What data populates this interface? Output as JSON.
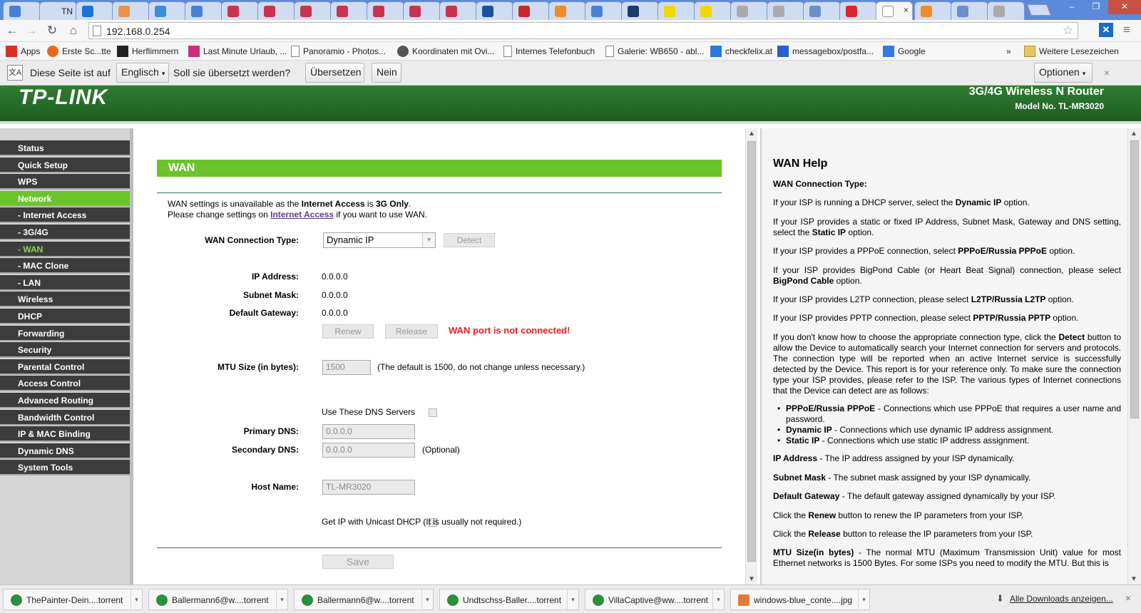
{
  "tabs": [
    {
      "label": "",
      "color": "#4a7fd6"
    },
    {
      "label": "TN",
      "color": "#cfdcf2"
    },
    {
      "label": "",
      "color": "#1a73d9"
    },
    {
      "label": "",
      "color": "#e8924c"
    },
    {
      "label": "",
      "color": "#3b8fd6"
    },
    {
      "label": "",
      "color": "#4a7fd6"
    },
    {
      "label": "",
      "color": "#c8344e"
    },
    {
      "label": "",
      "color": "#c8344e"
    },
    {
      "label": "",
      "color": "#c8344e"
    },
    {
      "label": "",
      "color": "#c8344e"
    },
    {
      "label": "",
      "color": "#c8344e"
    },
    {
      "label": "",
      "color": "#c8344e"
    },
    {
      "label": "",
      "color": "#c8344e"
    },
    {
      "label": "",
      "color": "#1a4fa0"
    },
    {
      "label": "",
      "color": "#c62828"
    },
    {
      "label": "",
      "color": "#f08c28"
    },
    {
      "label": "",
      "color": "#4a7fd6"
    },
    {
      "label": "",
      "color": "#1c3a6b"
    },
    {
      "label": "",
      "color": "#f2d600"
    },
    {
      "label": "",
      "color": "#f2d600"
    },
    {
      "label": "",
      "color": "#aaaaaa"
    },
    {
      "label": "",
      "color": "#aaaaaa"
    },
    {
      "label": "",
      "color": "#6b8fc6"
    },
    {
      "label": "",
      "color": "#d9272e"
    }
  ],
  "active_tab": {
    "label": "",
    "close": "×"
  },
  "after_tabs": [
    {
      "label": "",
      "color": "#f08c28"
    },
    {
      "label": "",
      "color": "#6b8fc6"
    },
    {
      "label": "",
      "color": "#aaaaaa"
    }
  ],
  "window_controls": {
    "minimize": "–",
    "restore": "❐",
    "close": "✕"
  },
  "nav": {
    "back": "←",
    "forward": "→",
    "reload": "↻",
    "home": "⌂"
  },
  "address": {
    "url": "192.168.0.254",
    "star": "☆"
  },
  "menu_icon": "≡",
  "extension_icon": "✕",
  "bookmarks": [
    {
      "label": "Apps",
      "icon": "apps-icon"
    },
    {
      "label": "Erste Sc...tte",
      "icon": "firefox-icon"
    },
    {
      "label": "Herflimmern",
      "icon": "l-icon"
    },
    {
      "label": "Last Minute Urlaub, ...",
      "icon": "palm-icon"
    },
    {
      "label": "Panoramio - Photos...",
      "icon": "page-icon"
    },
    {
      "label": "Koordinaten mit Ovi...",
      "icon": "wordpress-icon"
    },
    {
      "label": "Internes Telefonbuch",
      "icon": "page-icon"
    },
    {
      "label": "Galerie: WB650 - abl...",
      "icon": "page-icon"
    },
    {
      "label": "checkfelix.at",
      "icon": "plane-icon"
    },
    {
      "label": "messagebox/postfa...",
      "icon": "mail-icon"
    },
    {
      "label": "Google",
      "icon": "google-icon"
    }
  ],
  "bookmarks_more": "»",
  "bookmarks_other": "Weitere Lesezeichen",
  "translate": {
    "prefix": "Diese Seite ist auf",
    "language": "Englisch",
    "question": "Soll sie übersetzt werden?",
    "translate_btn": "Übersetzen",
    "no_btn": "Nein",
    "options_btn": "Optionen",
    "close": "×"
  },
  "router": {
    "brand": "TP-LINK",
    "product": "3G/4G Wireless N Router",
    "model": "Model No. TL-MR3020"
  },
  "menu": [
    {
      "label": "Status",
      "type": "top"
    },
    {
      "label": "Quick Setup",
      "type": "top"
    },
    {
      "label": "WPS",
      "type": "top"
    },
    {
      "label": "Network",
      "type": "selected"
    },
    {
      "label": "- Internet Access",
      "type": "sub"
    },
    {
      "label": "- 3G/4G",
      "type": "sub"
    },
    {
      "label": "- WAN",
      "type": "subsel"
    },
    {
      "label": "- MAC Clone",
      "type": "sub"
    },
    {
      "label": "- LAN",
      "type": "sub"
    },
    {
      "label": "Wireless",
      "type": "top"
    },
    {
      "label": "DHCP",
      "type": "top"
    },
    {
      "label": "Forwarding",
      "type": "top"
    },
    {
      "label": "Security",
      "type": "top"
    },
    {
      "label": "Parental Control",
      "type": "top"
    },
    {
      "label": "Access Control",
      "type": "top"
    },
    {
      "label": "Advanced Routing",
      "type": "top"
    },
    {
      "label": "Bandwidth Control",
      "type": "top"
    },
    {
      "label": "IP & MAC Binding",
      "type": "top"
    },
    {
      "label": "Dynamic DNS",
      "type": "top"
    },
    {
      "label": "System Tools",
      "type": "top"
    }
  ],
  "wan": {
    "title": "WAN",
    "notice_line1_a": "WAN settings is unavailable as the ",
    "notice_line1_b": "Internet Access",
    "notice_line1_c": " is ",
    "notice_line1_d": "3G Only",
    "notice_line1_e": ".",
    "notice_line2_a": "Please change settings on ",
    "notice_line2_link": "Internet Access",
    "notice_line2_c": " if you want to use WAN.",
    "conn_type_label": "WAN Connection Type:",
    "conn_type_value": "Dynamic IP",
    "detect_btn": "Detect",
    "ip_label": "IP Address:",
    "ip_value": "0.0.0.0",
    "mask_label": "Subnet Mask:",
    "mask_value": "0.0.0.0",
    "gw_label": "Default Gateway:",
    "gw_value": "0.0.0.0",
    "renew_btn": "Renew",
    "release_btn": "Release",
    "port_status": "WAN port is not connected!",
    "mtu_label": "MTU Size (in bytes):",
    "mtu_value": "1500",
    "mtu_hint": "(The default is 1500, do not change unless necessary.)",
    "dns_check_label": "Use These DNS Servers",
    "pdns_label": "Primary DNS:",
    "pdns_value": "0.0.0.0",
    "sdns_label": "Secondary DNS:",
    "sdns_value": "0.0.0.0",
    "sdns_hint": "(Optional)",
    "host_label": "Host Name:",
    "host_value": "TL-MR3020",
    "unicast_label": "Get IP with Unicast DHCP (It is usually not required.)",
    "save_btn": "Save"
  },
  "help": {
    "title": "WAN Help",
    "conn_heading": "WAN Connection Type:",
    "p1_a": "If your ISP is running a DHCP server, select the ",
    "p1_b": "Dynamic IP",
    "p1_c": " option.",
    "p2_a": "If your ISP provides a static or fixed IP Address, Subnet Mask, Gateway and DNS setting, select the ",
    "p2_b": "Static IP",
    "p2_c": " option.",
    "p3_a": "If your ISP provides a PPPoE connection, select ",
    "p3_b": "PPPoE/Russia PPPoE",
    "p3_c": " option.",
    "p4_a": "If your ISP provides BigPond Cable (or Heart Beat Signal) connection, please select ",
    "p4_b": "BigPond Cable",
    "p4_c": " option.",
    "p5_a": "If your ISP provides L2TP connection, please select ",
    "p5_b": "L2TP/Russia L2TP",
    "p5_c": " option.",
    "p6_a": "If your ISP provides PPTP connection, please select ",
    "p6_b": "PPTP/Russia PPTP",
    "p6_c": " option.",
    "p7_a": "If you don't know how to choose the appropriate connection type, click the ",
    "p7_b": "Detect",
    "p7_c": " button to allow the Device to automatically search your Internet connection for servers and protocols. The connection type will be reported when an active Internet service is successfully detected by the Device. This report is for your reference only. To make sure the connection type your ISP provides, please refer to the ISP. The various types of Internet connections that the Device can detect are as follows:",
    "b1_a": "PPPoE/Russia PPPoE",
    "b1_b": " - Connections which use PPPoE that requires a user name and password.",
    "b2_a": "Dynamic IP",
    "b2_b": " - Connections which use dynamic IP address assignment.",
    "b3_a": "Static IP",
    "b3_b": " - Connections which use static IP address assignment.",
    "ip_a": "IP Address",
    "ip_b": " - The IP address assigned by your ISP dynamically.",
    "mask_a": "Subnet Mask",
    "mask_b": " - The subnet mask assigned by your ISP dynamically.",
    "gw_a": "Default Gateway",
    "gw_b": " - The default gateway assigned dynamically by your ISP.",
    "renew_a": "Click the ",
    "renew_b": "Renew",
    "renew_c": " button to renew the IP parameters from your ISP.",
    "rel_a": "Click the ",
    "rel_b": "Release",
    "rel_c": " button to release the IP parameters from your ISP.",
    "mtu_a": "MTU Size(in bytes)",
    "mtu_b": " - The normal MTU (Maximum Transmission Unit) value for most Ethernet networks is 1500 Bytes. For some ISPs you need to modify the MTU. But this is"
  },
  "downloads": [
    {
      "name": "ThePainter-Dein....torrent"
    },
    {
      "name": "Ballermann6@w....torrent"
    },
    {
      "name": "Ballermann6@w....torrent"
    },
    {
      "name": "Undtschss-Baller....torrent"
    },
    {
      "name": "VillaCaptive@ww....torrent"
    },
    {
      "name": "windows-blue_conte....jpg"
    }
  ],
  "show_all_downloads": "Alle Downloads anzeigen...",
  "dl_close": "×"
}
